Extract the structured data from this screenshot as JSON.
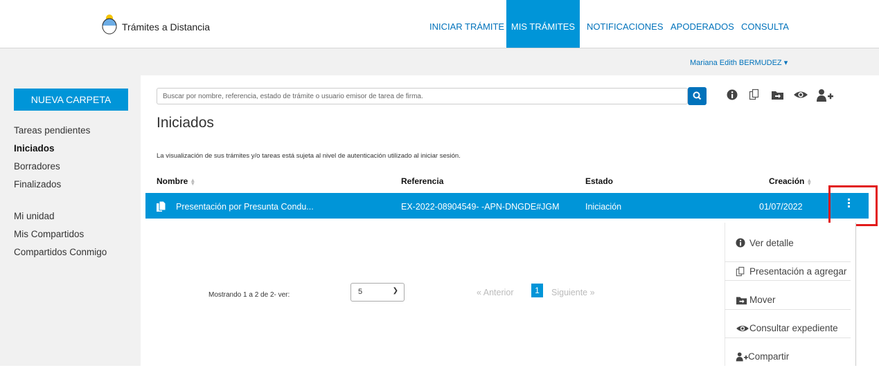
{
  "header": {
    "brand": "Trámites a Distancia",
    "nav": [
      {
        "label": "INICIAR TRÁMITE"
      },
      {
        "label": "MIS TRÁMITES"
      },
      {
        "label": "NOTIFICACIONES"
      },
      {
        "label": "APODERADOS"
      },
      {
        "label": "CONSULTA"
      }
    ],
    "active_nav": "MIS TRÁMITES",
    "user": "Mariana Edith BERMUDEZ"
  },
  "sidebar": {
    "new_folder": "NUEVA CARPETA",
    "items": [
      {
        "label": "Tareas pendientes"
      },
      {
        "label": "Iniciados"
      },
      {
        "label": "Borradores"
      },
      {
        "label": "Finalizados"
      },
      {
        "label": "Mi unidad"
      },
      {
        "label": "Mis Compartidos"
      },
      {
        "label": "Compartidos Conmigo"
      }
    ],
    "selected": "Iniciados"
  },
  "search": {
    "placeholder": "Buscar por nombre, referencia, estado de trámite o usuario emisor de tarea de firma."
  },
  "main": {
    "title": "Iniciados",
    "note": "La visualización de sus trámites y/o tareas está sujeta al nivel de autenticación utilizado al iniciar sesión.",
    "columns": [
      "Nombre",
      "Referencia",
      "Estado",
      "Creación"
    ],
    "rows": [
      {
        "nombre": "Presentación por Presunta Condu...",
        "referencia": "EX-2022-08904549- -APN-DNGDE#JGM",
        "estado": "Iniciación",
        "creacion": "01/07/2022"
      }
    ]
  },
  "pagination": {
    "showing": "Mostrando 1 a 2 de 2- ver:",
    "page_size": "5",
    "prev": "« Anterior",
    "current": "1",
    "next": "Siguiente »"
  },
  "context_menu": {
    "items": [
      {
        "label": "Ver detalle",
        "icon": "info-icon"
      },
      {
        "label": "Presentación a agregar",
        "icon": "copy-icon"
      },
      {
        "label": "Mover",
        "icon": "move-folder-icon"
      },
      {
        "label": "Consultar expediente",
        "icon": "eye-icon"
      },
      {
        "label": "Compartir",
        "icon": "add-user-icon"
      }
    ]
  },
  "colors": {
    "primary": "#0095d8",
    "link": "#0072bb",
    "highlight": "#e21a1a"
  }
}
